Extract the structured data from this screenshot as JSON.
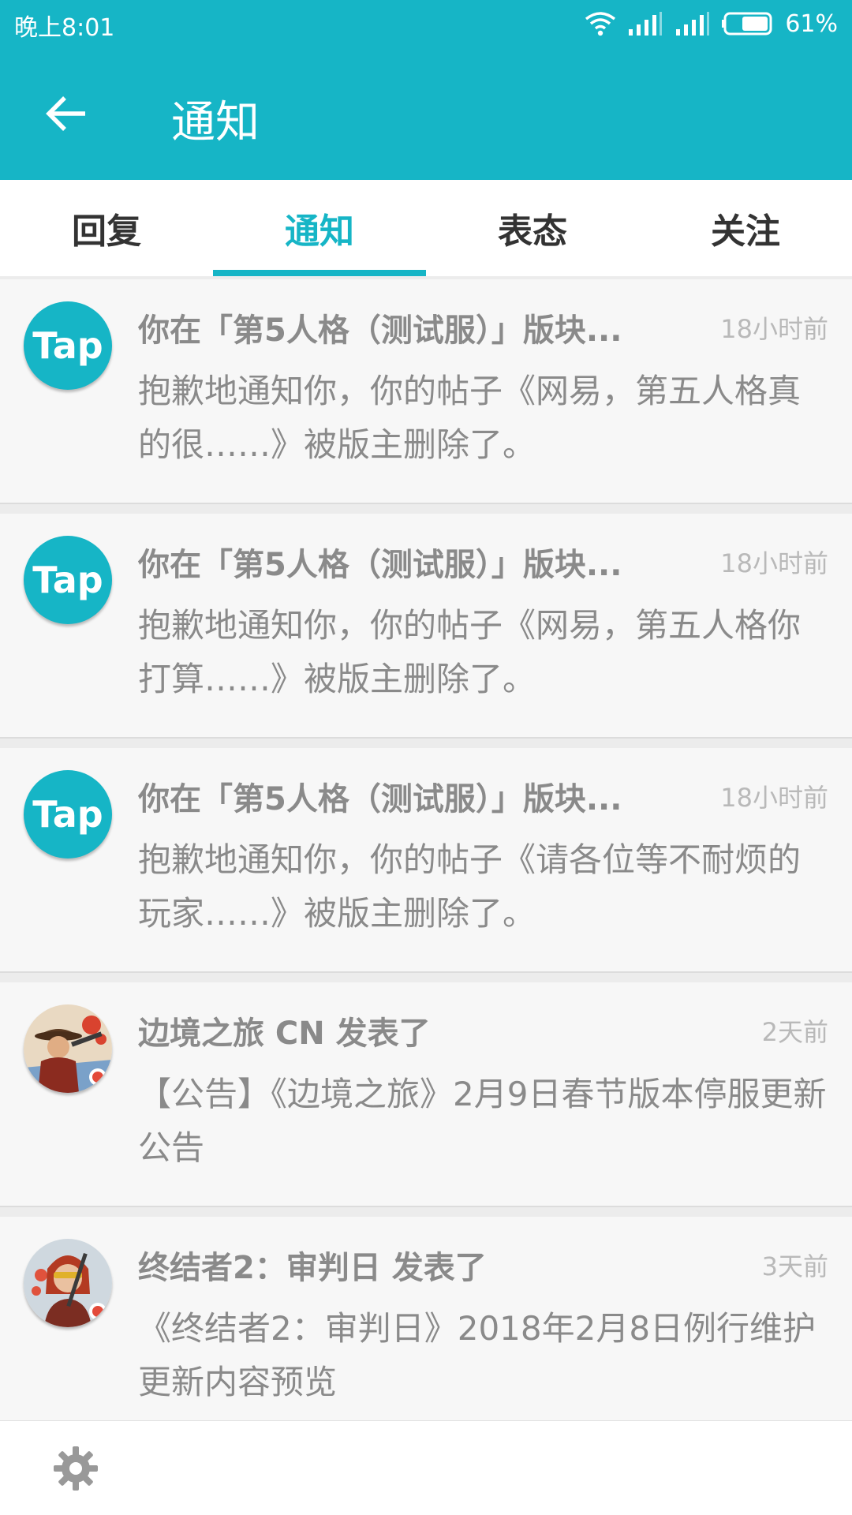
{
  "status": {
    "time": "晚上8:01",
    "battery": "61%"
  },
  "header": {
    "title": "通知"
  },
  "tabs": [
    {
      "label": "回复"
    },
    {
      "label": "通知"
    },
    {
      "label": "表态"
    },
    {
      "label": "关注"
    }
  ],
  "active_tab": "通知",
  "notifications": [
    {
      "avatar_text": "Tap",
      "title": "你在「第5人格（测试服）」版块...",
      "time": "18小时前",
      "body": "抱歉地通知你，你的帖子《网易，第五人格真的很……》被版主删除了。"
    },
    {
      "avatar_text": "Tap",
      "title": "你在「第5人格（测试服）」版块...",
      "time": "18小时前",
      "body": "抱歉地通知你，你的帖子《网易，第五人格你打算……》被版主删除了。"
    },
    {
      "avatar_text": "Tap",
      "title": "你在「第5人格（测试服）」版块...",
      "time": "18小时前",
      "body": "抱歉地通知你，你的帖子《请各位等不耐烦的玩家……》被版主删除了。"
    },
    {
      "title": "边境之旅 CN 发表了",
      "time": "2天前",
      "body": "【公告】《边境之旅》2月9日春节版本停服更新公告"
    },
    {
      "title": "终结者2：审判日 发表了",
      "time": "3天前",
      "body": "《终结者2：审判日》2018年2月8日例行维护更新内容预览"
    }
  ],
  "colors": {
    "accent": "#16b5c6",
    "item_bg": "#f7f7f7",
    "text_muted": "#8a8a8a"
  },
  "icons": {
    "back": "arrow-left-icon",
    "settings": "gear-icon",
    "wifi": "wifi-icon",
    "signal": "signal-icon",
    "battery": "battery-icon"
  }
}
